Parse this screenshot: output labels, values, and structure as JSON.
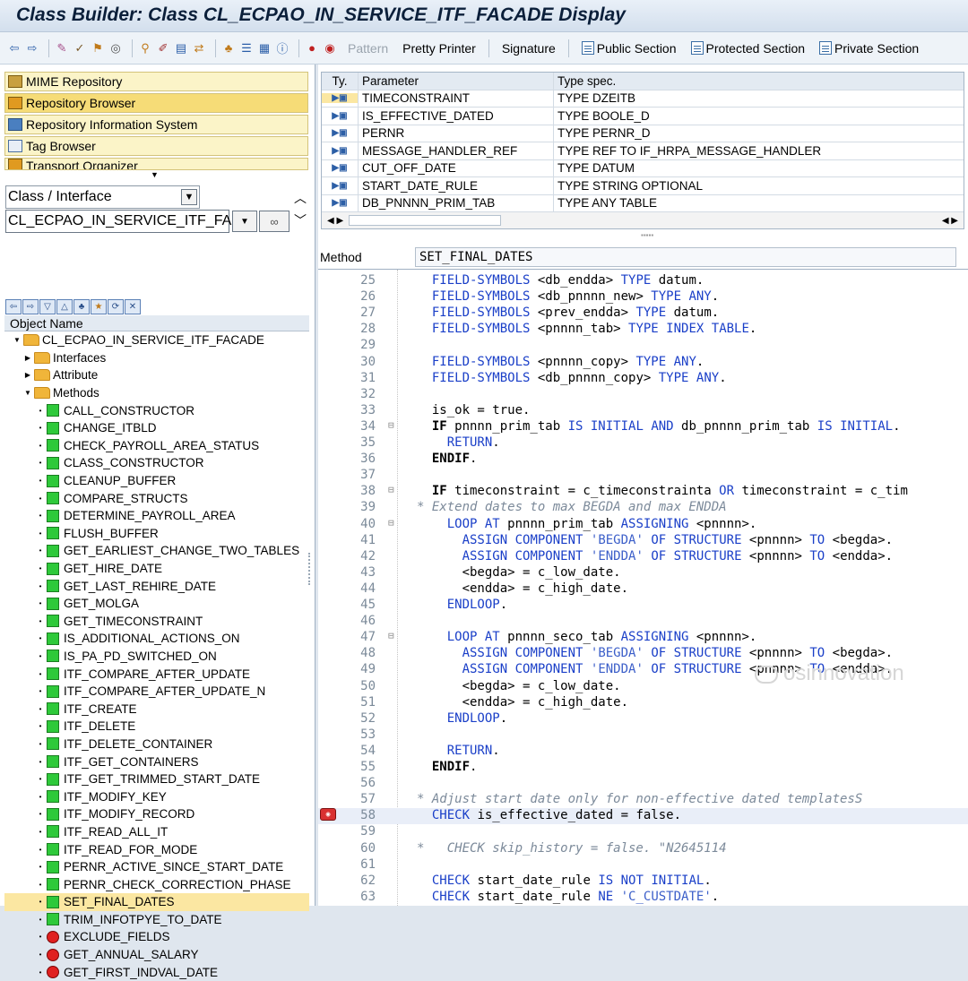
{
  "window": {
    "title": "Class Builder: Class CL_ECPAO_IN_SERVICE_ITF_FACADE Display"
  },
  "toolbar": {
    "icons": [
      "back-icon",
      "forward-icon",
      "toggle-icon",
      "check-icon",
      "activate-icon",
      "test-icon",
      "where-used-icon",
      "object-list-icon",
      "display-object-list-icon",
      "hierarchy-icon",
      "enhance-icon",
      "info-icon",
      "breakpoint-icon",
      "session-breakpoint-icon"
    ],
    "pattern_label": "Pattern",
    "pretty_printer_label": "Pretty Printer",
    "signature_label": "Signature",
    "public_section_label": "Public Section",
    "protected_section_label": "Protected Section",
    "private_section_label": "Private Section"
  },
  "navigation": {
    "items": [
      {
        "label": "MIME Repository"
      },
      {
        "label": "Repository Browser"
      },
      {
        "label": "Repository Information System"
      },
      {
        "label": "Tag Browser"
      },
      {
        "label": "Transport Organizer"
      }
    ],
    "object_type": "Class / Interface",
    "object_name": "CL_ECPAO_IN_SERVICE_ITF_FAC",
    "object_name_header": "Object Name"
  },
  "tree": {
    "root": "CL_ECPAO_IN_SERVICE_ITF_FACADE",
    "interfaces": "Interfaces",
    "attribute": "Attribute",
    "methods_label": "Methods",
    "methods": [
      "CALL_CONSTRUCTOR",
      "CHANGE_ITBLD",
      "CHECK_PAYROLL_AREA_STATUS",
      "CLASS_CONSTRUCTOR",
      "CLEANUP_BUFFER",
      "COMPARE_STRUCTS",
      "DETERMINE_PAYROLL_AREA",
      "FLUSH_BUFFER",
      "GET_EARLIEST_CHANGE_TWO_TABLES",
      "GET_HIRE_DATE",
      "GET_LAST_REHIRE_DATE",
      "GET_MOLGA",
      "GET_TIMECONSTRAINT",
      "IS_ADDITIONAL_ACTIONS_ON",
      "IS_PA_PD_SWITCHED_ON",
      "ITF_COMPARE_AFTER_UPDATE",
      "ITF_COMPARE_AFTER_UPDATE_N",
      "ITF_CREATE",
      "ITF_DELETE",
      "ITF_DELETE_CONTAINER",
      "ITF_GET_CONTAINERS",
      "ITF_GET_TRIMMED_START_DATE",
      "ITF_MODIFY_KEY",
      "ITF_MODIFY_RECORD",
      "ITF_READ_ALL_IT",
      "ITF_READ_FOR_MODE",
      "PERNR_ACTIVE_SINCE_START_DATE",
      "PERNR_CHECK_CORRECTION_PHASE",
      "SET_FINAL_DATES",
      "TRIM_INFOTPYE_TO_DATE"
    ],
    "private_methods": [
      "EXCLUDE_FIELDS",
      "GET_ANNUAL_SALARY",
      "GET_FIRST_INDVAL_DATE"
    ],
    "selected": "SET_FINAL_DATES"
  },
  "params": {
    "headers": {
      "ty": "Ty.",
      "param": "Parameter",
      "type": "Type spec."
    },
    "rows": [
      {
        "ty": "▶▣",
        "name": "TIMECONSTRAINT",
        "type": "TYPE DZEITB"
      },
      {
        "ty": "▶▣",
        "name": "IS_EFFECTIVE_DATED",
        "type": "TYPE BOOLE_D"
      },
      {
        "ty": "▶▣",
        "name": "PERNR",
        "type": "TYPE PERNR_D"
      },
      {
        "ty": "▶▣",
        "name": "MESSAGE_HANDLER_REF",
        "type": "TYPE REF TO IF_HRPA_MESSAGE_HANDLER"
      },
      {
        "ty": "▶▣",
        "name": "CUT_OFF_DATE",
        "type": "TYPE DATUM"
      },
      {
        "ty": "▶▣",
        "name": "START_DATE_RULE",
        "type": "TYPE STRING OPTIONAL"
      },
      {
        "ty": "▶▣",
        "name": "DB_PNNNN_PRIM_TAB",
        "type": "TYPE ANY TABLE"
      }
    ]
  },
  "method": {
    "label": "Method",
    "name": "SET_FINAL_DATES"
  },
  "code": {
    "lines": [
      {
        "n": "25",
        "t": "  FIELD-SYMBOLS <db_endda> TYPE datum."
      },
      {
        "n": "26",
        "t": "  FIELD-SYMBOLS <db_pnnnn_new> TYPE ANY."
      },
      {
        "n": "27",
        "t": "  FIELD-SYMBOLS <prev_endda> TYPE datum."
      },
      {
        "n": "28",
        "t": "  FIELD-SYMBOLS <pnnnn_tab> TYPE INDEX TABLE."
      },
      {
        "n": "29",
        "t": ""
      },
      {
        "n": "30",
        "t": "  FIELD-SYMBOLS <pnnnn_copy> TYPE ANY."
      },
      {
        "n": "31",
        "t": "  FIELD-SYMBOLS <db_pnnnn_copy> TYPE ANY."
      },
      {
        "n": "32",
        "t": ""
      },
      {
        "n": "33",
        "t": "  is_ok = true."
      },
      {
        "n": "34",
        "t": "  IF pnnnn_prim_tab IS INITIAL AND db_pnnnn_prim_tab IS INITIAL."
      },
      {
        "n": "35",
        "t": "    RETURN."
      },
      {
        "n": "36",
        "t": "  ENDIF."
      },
      {
        "n": "37",
        "t": ""
      },
      {
        "n": "38",
        "t": "  IF timeconstraint = c_timeconstrainta OR timeconstraint = c_tim"
      },
      {
        "n": "39",
        "t": "* Extend dates to max BEGDA and max ENDDA"
      },
      {
        "n": "40",
        "t": "    LOOP AT pnnnn_prim_tab ASSIGNING <pnnnn>."
      },
      {
        "n": "41",
        "t": "      ASSIGN COMPONENT 'BEGDA' OF STRUCTURE <pnnnn> TO <begda>."
      },
      {
        "n": "42",
        "t": "      ASSIGN COMPONENT 'ENDDA' OF STRUCTURE <pnnnn> TO <endda>."
      },
      {
        "n": "43",
        "t": "      <begda> = c_low_date."
      },
      {
        "n": "44",
        "t": "      <endda> = c_high_date."
      },
      {
        "n": "45",
        "t": "    ENDLOOP."
      },
      {
        "n": "46",
        "t": ""
      },
      {
        "n": "47",
        "t": "    LOOP AT pnnnn_seco_tab ASSIGNING <pnnnn>."
      },
      {
        "n": "48",
        "t": "      ASSIGN COMPONENT 'BEGDA' OF STRUCTURE <pnnnn> TO <begda>."
      },
      {
        "n": "49",
        "t": "      ASSIGN COMPONENT 'ENDDA' OF STRUCTURE <pnnnn> TO <endda>."
      },
      {
        "n": "50",
        "t": "      <begda> = c_low_date."
      },
      {
        "n": "51",
        "t": "      <endda> = c_high_date."
      },
      {
        "n": "52",
        "t": "    ENDLOOP."
      },
      {
        "n": "53",
        "t": ""
      },
      {
        "n": "54",
        "t": "    RETURN."
      },
      {
        "n": "55",
        "t": "  ENDIF."
      },
      {
        "n": "56",
        "t": ""
      },
      {
        "n": "57",
        "t": "* Adjust start date only for non-effective dated templatesS"
      },
      {
        "n": "58",
        "t": "  CHECK is_effective_dated = false."
      },
      {
        "n": "59",
        "t": ""
      },
      {
        "n": "60",
        "t": "*   CHECK skip_history = false. \"N2645114"
      },
      {
        "n": "61",
        "t": ""
      },
      {
        "n": "62",
        "t": "  CHECK start_date_rule IS NOT INITIAL."
      },
      {
        "n": "63",
        "t": "  CHECK start_date_rule NE 'C_CUSTDATE'."
      }
    ]
  },
  "watermark": "osinnovation"
}
